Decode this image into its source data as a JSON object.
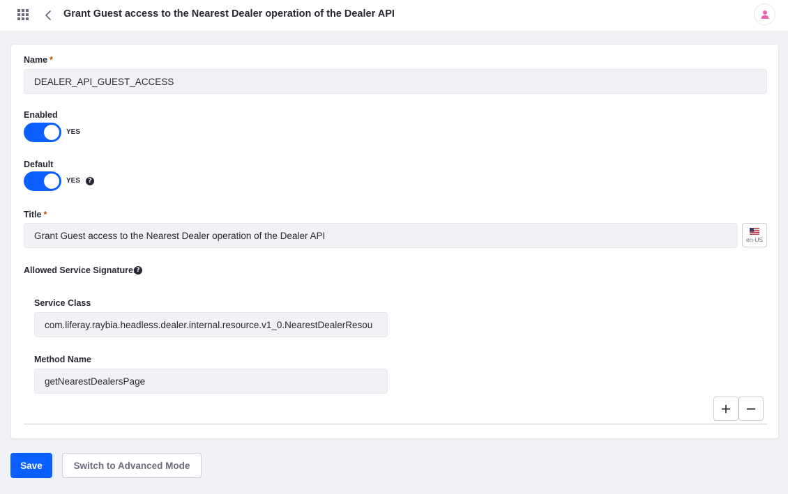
{
  "header": {
    "apps_icon": "apps-grid-icon",
    "back_icon": "chevron-left-icon",
    "title": "Grant Guest access to the Nearest Dealer operation of the Dealer API",
    "user_icon": "user-icon"
  },
  "form": {
    "name": {
      "label": "Name",
      "required_mark": "*",
      "value": "DEALER_API_GUEST_ACCESS"
    },
    "enabled": {
      "label": "Enabled",
      "state_text": "YES",
      "on": true
    },
    "default": {
      "label": "Default",
      "state_text": "YES",
      "on": true,
      "help_icon": "question-circle-icon",
      "help_glyph": "?"
    },
    "title": {
      "label": "Title",
      "required_mark": "*",
      "value": "Grant Guest access to the Nearest Dealer operation of the Dealer API",
      "locale": "en-US",
      "locale_icon": "us-flag-icon"
    },
    "signatures": {
      "label": "Allowed Service Signatures",
      "help_glyph": "?",
      "service_class_label": "Service Class",
      "service_class_value": "com.liferay.raybia.headless.dealer.internal.resource.v1_0.NearestDealerResou",
      "method_name_label": "Method Name",
      "method_name_value": "getNearestDealersPage",
      "add_icon": "plus-icon",
      "remove_icon": "minus-icon"
    }
  },
  "footer": {
    "save_label": "Save",
    "advanced_label": "Switch to Advanced Mode"
  },
  "colors": {
    "primary": "#0b5fff",
    "required": "#b95000",
    "avatar_accent": "#f163ae"
  }
}
